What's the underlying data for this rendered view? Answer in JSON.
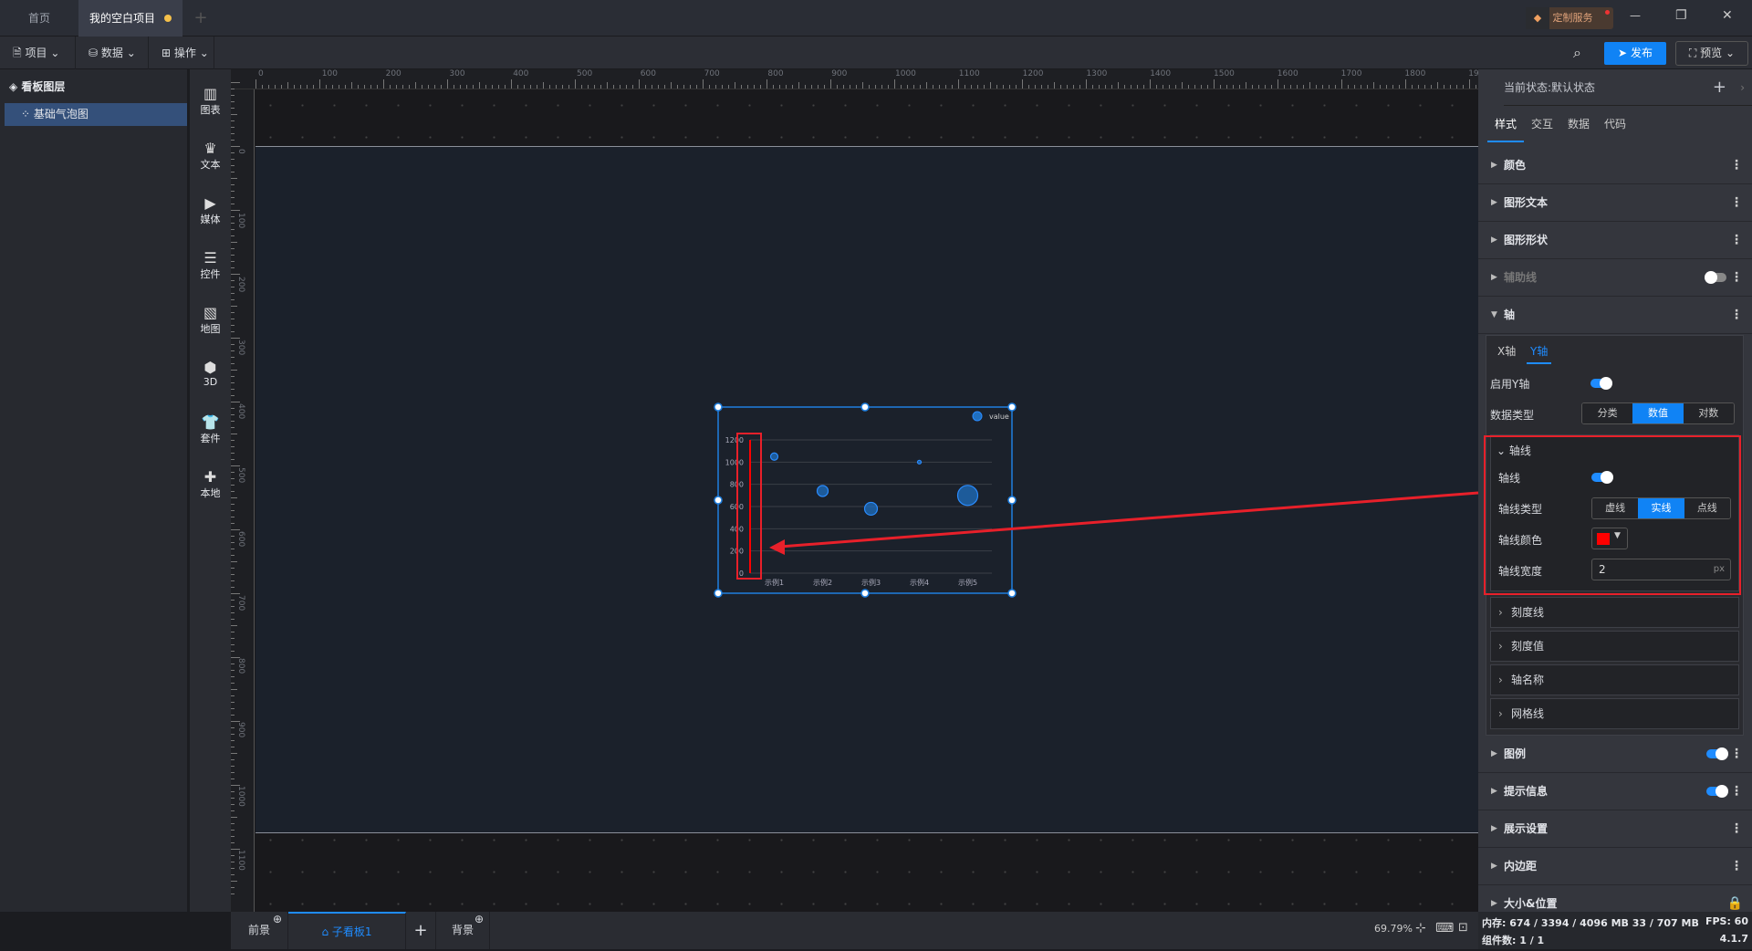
{
  "titlebar": {
    "tabs": [
      {
        "label": "首页"
      },
      {
        "label": "我的空白项目",
        "unsaved": true
      }
    ],
    "add_tab": "+",
    "custom_service": "定制服务",
    "window": {
      "minimize": "—",
      "restore": "❐",
      "close": "✕"
    }
  },
  "toolbar": {
    "menus": [
      {
        "label": "项目",
        "icon": "file-icon"
      },
      {
        "label": "数据",
        "icon": "database-icon"
      },
      {
        "label": "操作",
        "icon": "grid-icon"
      }
    ],
    "publish": "发布",
    "preview": "预览"
  },
  "layers": {
    "title": "看板图层",
    "items": [
      {
        "label": "基础气泡图",
        "selected": true
      }
    ]
  },
  "iconbar": [
    {
      "label": "图表",
      "icon": "bar-chart-icon"
    },
    {
      "label": "文本",
      "icon": "crown-icon"
    },
    {
      "label": "媒体",
      "icon": "video-icon"
    },
    {
      "label": "控件",
      "icon": "list-icon"
    },
    {
      "label": "地图",
      "icon": "map-icon"
    },
    {
      "label": "3D",
      "icon": "cube-icon"
    },
    {
      "label": "套件",
      "icon": "shirt-icon"
    },
    {
      "label": "本地",
      "icon": "puzzle-icon"
    }
  ],
  "rulers": {
    "top": [
      "0",
      "100",
      "200",
      "300",
      "400",
      "500",
      "600",
      "700",
      "800",
      "900",
      "1000",
      "1100",
      "1200",
      "1300",
      "1400",
      "1500",
      "1600",
      "1700",
      "1800",
      "1900"
    ],
    "left": [
      "0",
      "100",
      "200",
      "300",
      "400",
      "500",
      "600",
      "700",
      "800",
      "900",
      "1000",
      "1100"
    ]
  },
  "chart_data": {
    "type": "scatter",
    "subtype": "bubble",
    "categories": [
      "示例1",
      "示例2",
      "示例3",
      "示例4",
      "示例5"
    ],
    "series": [
      {
        "name": "value",
        "values": [
          1050,
          740,
          580,
          1000,
          700
        ],
        "bubble_size": [
          4,
          6,
          7,
          2,
          11
        ]
      }
    ],
    "yticks": [
      "0",
      "200",
      "400",
      "600",
      "800",
      "1000",
      "1200"
    ],
    "ylim": [
      0,
      1200
    ],
    "grid": true,
    "legend": "top-right",
    "color": "#1f6fc0",
    "y_axis_line_color": "#ff0000"
  },
  "bottombar": {
    "foreground": "前景",
    "subboard": "子看板1",
    "add": "+",
    "background": "背景",
    "zoom": "69.79%"
  },
  "rightpanel": {
    "state_label": "当前状态:",
    "state_value": "默认状态",
    "tabs": [
      "样式",
      "交互",
      "数据",
      "代码"
    ],
    "active_tab": "样式",
    "sections_top": [
      {
        "label": "颜色"
      },
      {
        "label": "图形文本"
      },
      {
        "label": "图形形状"
      },
      {
        "label": "辅助线",
        "toggle": false,
        "disabled": true
      },
      {
        "label": "轴",
        "expanded": true
      }
    ],
    "axis": {
      "tabs": [
        "X轴",
        "Y轴"
      ],
      "active": "Y轴",
      "enable_label": "启用Y轴",
      "enabled": true,
      "data_type_label": "数据类型",
      "data_types": [
        "分类",
        "数值",
        "对数"
      ],
      "data_type": "数值",
      "axis_line": {
        "title": "轴线",
        "toggle_label": "轴线",
        "enabled": true,
        "type_label": "轴线类型",
        "types": [
          "虚线",
          "实线",
          "点线"
        ],
        "type": "实线",
        "color_label": "轴线颜色",
        "color": "#ff0000",
        "width_label": "轴线宽度",
        "width": "2",
        "unit": "px"
      },
      "subsections": [
        "刻度线",
        "刻度值",
        "轴名称",
        "网格线"
      ]
    },
    "sections_bottom": [
      {
        "label": "图例",
        "toggle": true
      },
      {
        "label": "提示信息",
        "toggle": true
      },
      {
        "label": "展示设置"
      },
      {
        "label": "内边距"
      },
      {
        "label": "大小&位置",
        "locked": true
      }
    ]
  },
  "status": {
    "memory": "内存: 674 / 3394 / 4096 MB  33 / 707 MB",
    "fps": "FPS:  60",
    "components": "组件数: 1 / 1",
    "version": "4.1.7"
  },
  "accent": "#1083f5",
  "annotation_color": "#e8202a"
}
